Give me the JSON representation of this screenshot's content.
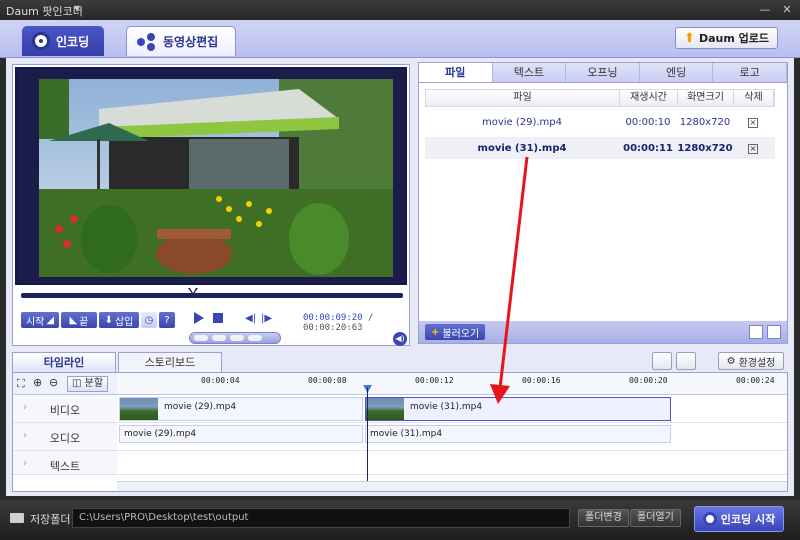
{
  "titlebar": {
    "title": "Daum 팟인코더"
  },
  "header": {
    "tab_encode": "인코딩",
    "tab_edit": "동영상편집",
    "upload_button": "Daum 업로드"
  },
  "player": {
    "btn_start": "시작",
    "btn_end": "끝",
    "btn_insert": "삽입",
    "help": "?",
    "time_current": "00:00:09:20",
    "time_separator": "/",
    "time_total": "00:00:20:63",
    "seek_position": 0.45
  },
  "filepanel": {
    "tabs": [
      "파일",
      "텍스트",
      "오프닝",
      "엔딩",
      "로고"
    ],
    "columns": [
      "파일",
      "재생시간",
      "화면크기",
      "삭제"
    ],
    "rows": [
      {
        "name": "movie (29).mp4",
        "duration": "00:00:10",
        "size": "1280x720",
        "delete": "×"
      },
      {
        "name": "movie (31).mp4",
        "duration": "00:00:11",
        "size": "1280x720",
        "delete": "×"
      }
    ],
    "import_button": "불러오기"
  },
  "timeline": {
    "tab_timeline": "타임라인",
    "tab_storyboard": "스토리보드",
    "settings_button": "환경설정",
    "split_button": "분할",
    "ticks": [
      "00:00:04",
      "00:00:08",
      "00:00:12",
      "00:00:16",
      "00:00:20",
      "00:00:24"
    ],
    "tracks": [
      "비디오",
      "오디오",
      "텍스트"
    ],
    "video_clips": [
      "movie (29).mp4",
      "movie (31).mp4"
    ],
    "audio_clips": [
      "movie (29).mp4",
      "movie (31).mp4"
    ]
  },
  "footer": {
    "save_label": "저장폴더",
    "save_path": "C:\\Users\\PRO\\Desktop\\test\\output",
    "change_folder": "폴더변경",
    "open_folder": "폴더열기",
    "start_encode": "인코딩 시작"
  }
}
